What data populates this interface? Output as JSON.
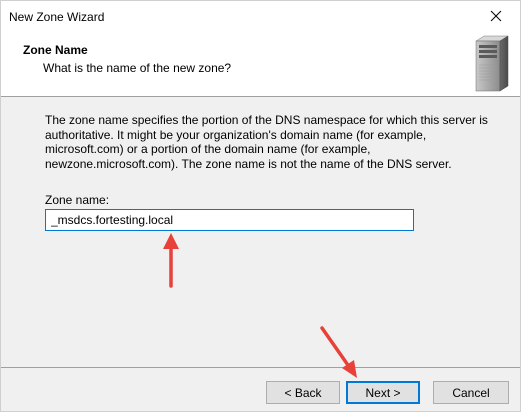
{
  "window": {
    "title": "New Zone Wizard"
  },
  "header": {
    "title": "Zone Name",
    "subtitle": "What is the name of the new zone?",
    "icon": "server-tower-icon"
  },
  "body": {
    "description": "The zone name specifies the portion of the DNS namespace for which this server is authoritative. It might be your organization's domain name (for example,  microsoft.com) or a portion of the domain name (for example, newzone.microsoft.com). The zone name is not the name of the DNS server.",
    "zone_name_label": "Zone name:",
    "zone_name_value": "_msdcs.fortesting.local"
  },
  "buttons": {
    "back": "< Back",
    "next": "Next >",
    "cancel": "Cancel"
  },
  "colors": {
    "focus": "#0078d7",
    "annotation_arrow": "#e8413a"
  }
}
